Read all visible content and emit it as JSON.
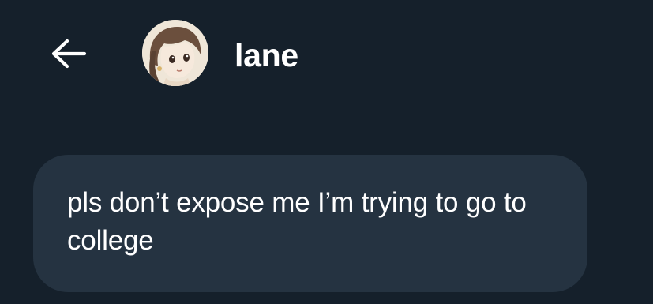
{
  "header": {
    "back_icon": "arrow-left-icon",
    "username": "lane",
    "avatar_icon": "anime-avatar"
  },
  "conversation": {
    "messages": [
      {
        "text": "pls don’t expose me I’m trying to go to college"
      }
    ]
  },
  "colors": {
    "background": "#15202b",
    "bubble": "#253341",
    "text": "#ffffff"
  }
}
